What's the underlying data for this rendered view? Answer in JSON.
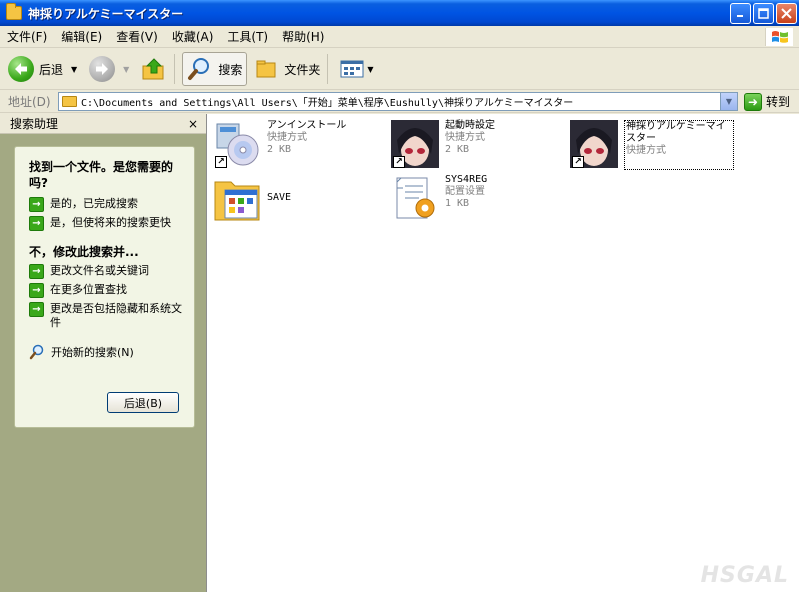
{
  "window": {
    "title": "神採りアルケミーマイスター"
  },
  "menu": {
    "items": [
      "文件(F)",
      "编辑(E)",
      "查看(V)",
      "收藏(A)",
      "工具(T)",
      "帮助(H)"
    ]
  },
  "toolbar": {
    "back_label": "后退",
    "search_label": "搜索",
    "folders_label": "文件夹"
  },
  "address": {
    "label": "地址(D)",
    "value": "C:\\Documents and Settings\\All Users\\「开始」菜单\\程序\\Eushully\\神採りアルケミーマイスター",
    "go_label": "转到"
  },
  "search_pane": {
    "title": "搜索助理",
    "close_label": "×",
    "question": "找到一个文件。是您需要的吗?",
    "yes_options": [
      "是的，已完成搜索",
      "是，但使将来的搜索更快"
    ],
    "refine_title": "不，修改此搜索并...",
    "refine_options": [
      "更改文件名或关键词",
      "在更多位置查找",
      "更改是否包括隐藏和系统文件"
    ],
    "new_search": "开始新的搜索(N)",
    "back_button": "后退(B)"
  },
  "files": [
    {
      "name": "アンインストール",
      "type": "快捷方式",
      "size": "2 KB",
      "icon": "uninstall-cd-icon"
    },
    {
      "name": "起動時設定",
      "type": "快捷方式",
      "size": "2 KB",
      "icon": "anime-character-icon"
    },
    {
      "name": "神採りアルケミーマイスター",
      "type": "快捷方式",
      "size": "",
      "icon": "anime-character-icon"
    },
    {
      "name": "SAVE",
      "type": "",
      "size": "",
      "icon": "folder-icon"
    },
    {
      "name": "SYS4REG",
      "type": "配置设置",
      "size": "1 KB",
      "icon": "config-settings-icon"
    }
  ],
  "watermark": "HSGAL",
  "colors": {
    "title_bar": "#0054e3",
    "pane_bg": "#a3a983",
    "card_bg": "#f2f5e5",
    "accent_green": "#3aa81a"
  }
}
